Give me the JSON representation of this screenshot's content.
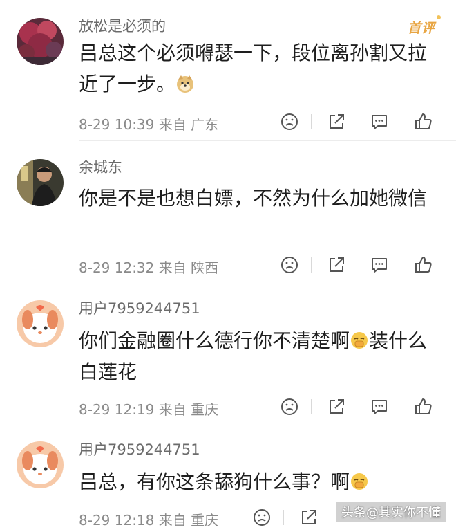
{
  "comments": [
    {
      "username": "放松是必须的",
      "badge": "首评",
      "text": "吕总这个必须嘚瑟一下，段位离孙割又拉近了一步。",
      "emoji": "doge-emoji",
      "time": "8-29 10:39",
      "location": "来自 广东"
    },
    {
      "username": "余城东",
      "text": "你是不是也想白嫖，不然为什么加她微信",
      "time": "8-29 12:32",
      "location": "来自 陕西"
    },
    {
      "username": "用户7959244751",
      "text_before": "你们金融圈什么德行你不清楚啊",
      "emoji": "facepalm-emoji",
      "text_after": "装什么白莲花",
      "time": "8-29 12:19",
      "location": "来自 重庆"
    },
    {
      "username": "用户7959244751",
      "text_before": "吕总，有你这条舔狗什么事？啊",
      "emoji": "facepalm-emoji",
      "time": "8-29 12:18",
      "location": "来自 重庆"
    }
  ],
  "actions": [
    "frown-icon",
    "share-icon",
    "comment-icon",
    "like-icon"
  ],
  "watermark": "头条@其实你不懂"
}
